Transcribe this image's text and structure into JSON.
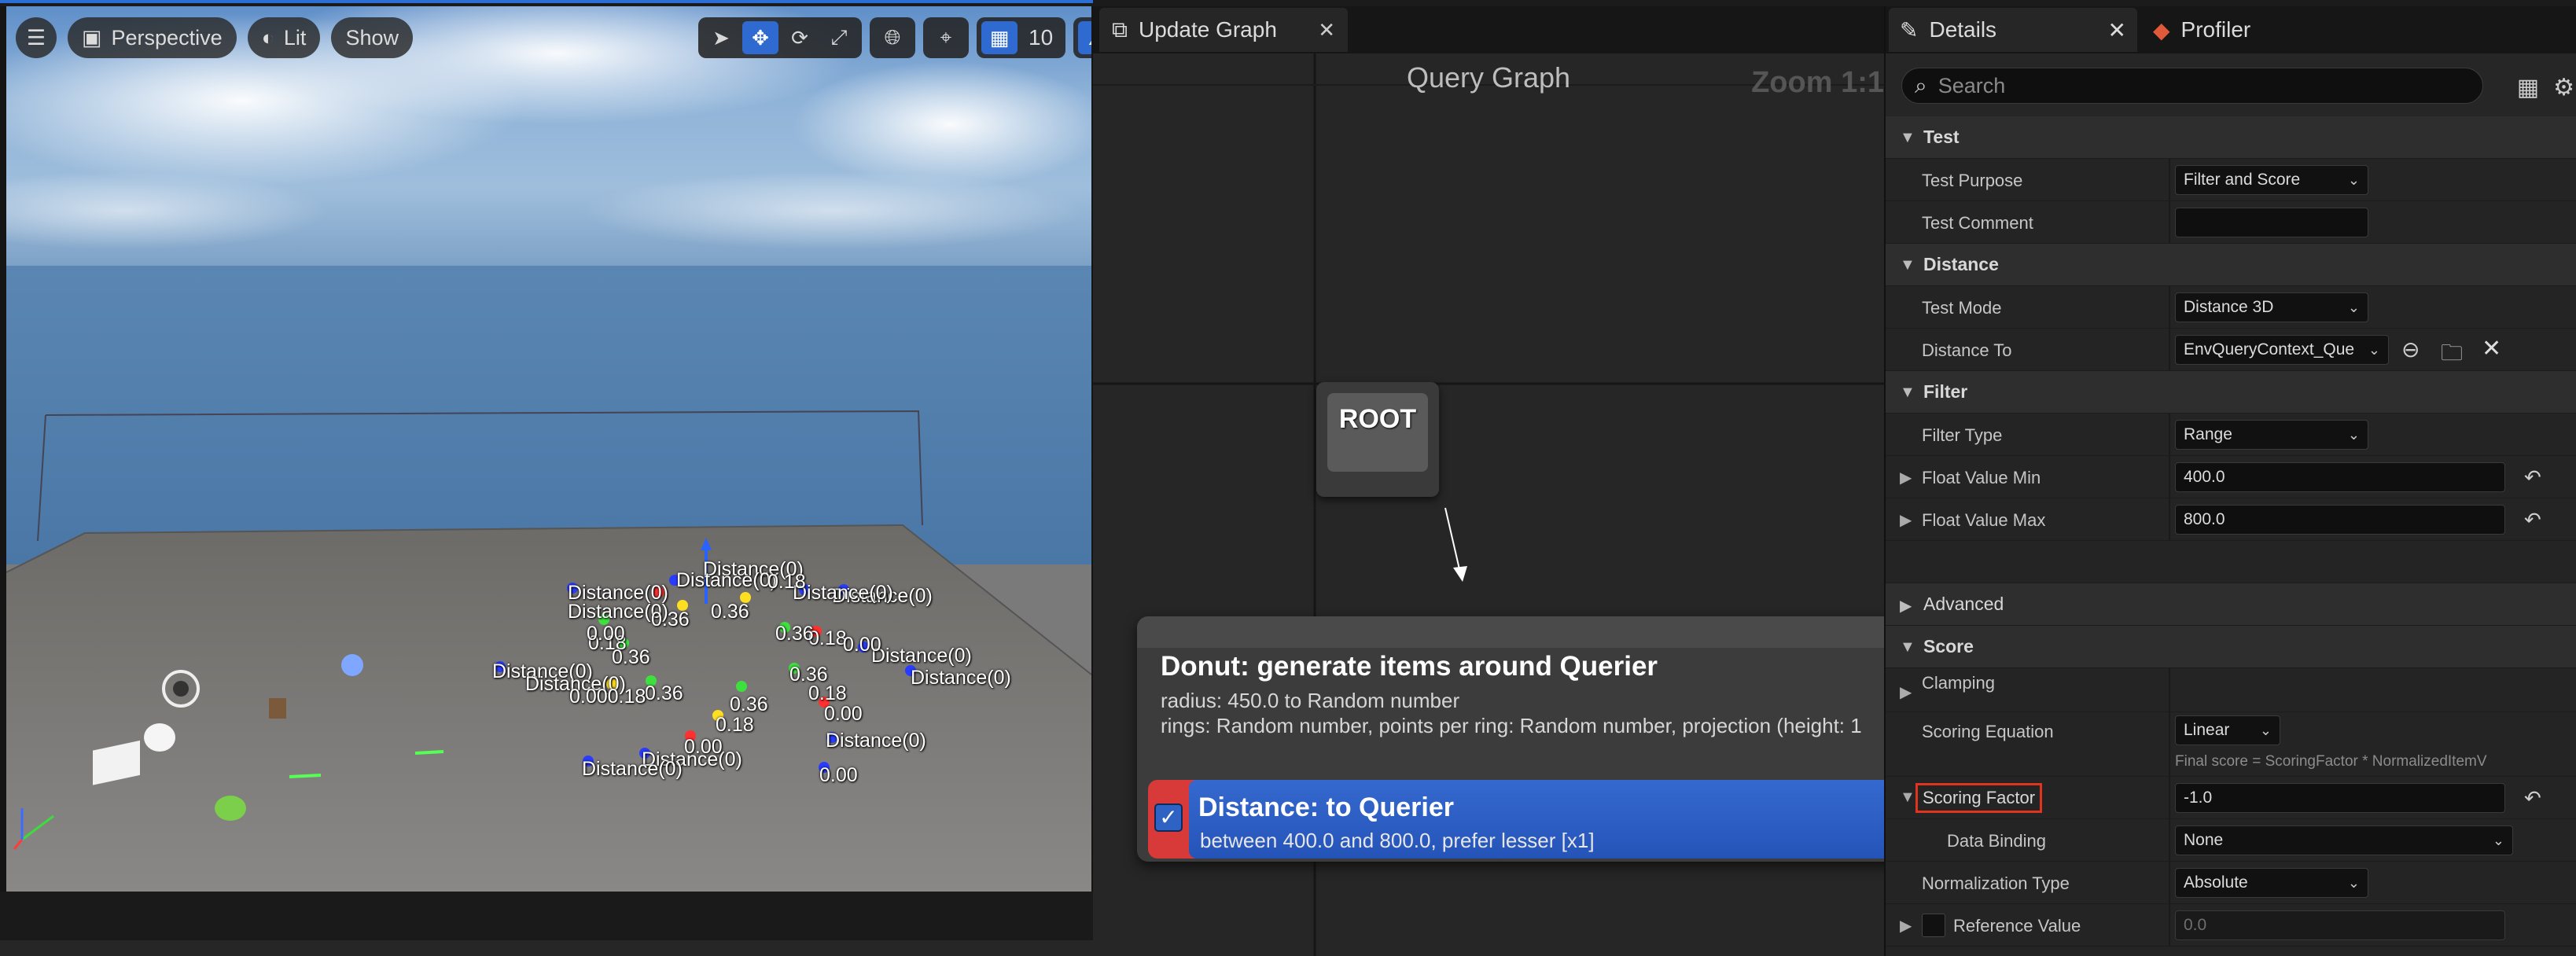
{
  "viewport": {
    "toolbar": {
      "menu_icon": "hamburger-icon",
      "perspective_label": "Perspective",
      "lit_label": "Lit",
      "show_label": "Show",
      "grid_snap_value": "10"
    },
    "labels": [
      {
        "text": "Distance(0)"
      },
      {
        "text": "Distance(0)"
      },
      {
        "text": "Distance(0)"
      },
      {
        "text": "Distance(0)"
      },
      {
        "text": "Distance(0)"
      },
      {
        "text": "Distance(0)"
      },
      {
        "text": "Distance(0)"
      },
      {
        "text": "Distance(0)"
      },
      {
        "text": "Distance(0)"
      },
      {
        "text": "Distance(0)"
      },
      {
        "text": "Distance(0)"
      },
      {
        "text": "Distance(0)"
      },
      {
        "text": "Distance(0)"
      },
      {
        "text": "0.00"
      },
      {
        "text": "0.18"
      },
      {
        "text": "0.36"
      },
      {
        "text": "0.36"
      },
      {
        "text": "0.18"
      },
      {
        "text": "0.36"
      },
      {
        "text": "0.18"
      },
      {
        "text": "0.00"
      },
      {
        "text": "0.36"
      },
      {
        "text": "0.36"
      },
      {
        "text": "0.18"
      },
      {
        "text": "0.00"
      },
      {
        "text": "0.00"
      },
      {
        "text": "0.00"
      },
      {
        "text": "0.18"
      },
      {
        "text": "0.36"
      },
      {
        "text": "0.36"
      },
      {
        "text": "0.000.18"
      }
    ]
  },
  "graph": {
    "tab_label": "Update Graph",
    "title": "Query Graph",
    "zoom": "Zoom 1:1",
    "root_label": "ROOT",
    "generator": {
      "title": "Donut: generate items around Querier",
      "line1": "radius: 450.0 to Random number",
      "line2": "rings: Random number, points per ring: Random number, projection (height: 1"
    },
    "test": {
      "title": "Distance: to Querier",
      "subtitle": "between 400.0 and 800.0, prefer lesser [x1]",
      "checked": true
    }
  },
  "details": {
    "tab_label": "Details",
    "profiler_label": "Profiler",
    "search_placeholder": "Search",
    "categories": {
      "test": "Test",
      "distance": "Distance",
      "filter": "Filter",
      "advanced": "Advanced",
      "score": "Score"
    },
    "props": {
      "test_purpose": {
        "label": "Test Purpose",
        "value": "Filter and Score"
      },
      "test_comment": {
        "label": "Test Comment",
        "value": ""
      },
      "test_mode": {
        "label": "Test Mode",
        "value": "Distance 3D"
      },
      "distance_to": {
        "label": "Distance To",
        "value": "EnvQueryContext_Que"
      },
      "filter_type": {
        "label": "Filter Type",
        "value": "Range"
      },
      "float_min": {
        "label": "Float Value Min",
        "value": "400.0"
      },
      "float_max": {
        "label": "Float Value Max",
        "value": "800.0"
      },
      "clamping": {
        "label": "Clamping"
      },
      "scoring_equation": {
        "label": "Scoring Equation",
        "value": "Linear",
        "hint": "Final score = ScoringFactor * NormalizedItemV"
      },
      "scoring_factor": {
        "label": "Scoring Factor",
        "value": "-1.0"
      },
      "data_binding": {
        "label": "Data Binding",
        "value": "None"
      },
      "normalization_type": {
        "label": "Normalization Type",
        "value": "Absolute"
      },
      "reference_value": {
        "label": "Reference Value",
        "value": "0.0"
      }
    }
  }
}
